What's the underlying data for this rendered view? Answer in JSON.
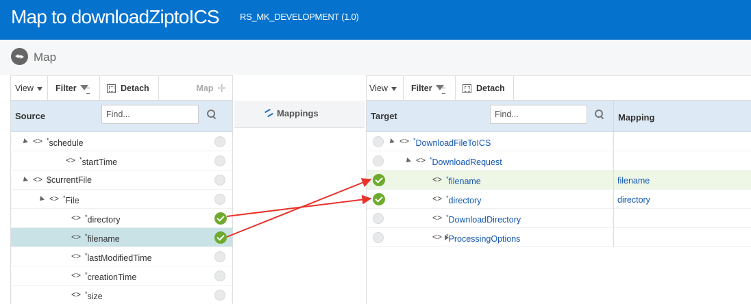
{
  "header": {
    "title": "Map to downloadZiptoICS",
    "subtitle": "RS_MK_DEVELOPMENT (1.0)",
    "accent": "#0572ce"
  },
  "breadcrumb": {
    "map_label": "Map",
    "icon": "map-nav-icon"
  },
  "source": {
    "toolbar": {
      "view": "View",
      "filter": "Filter",
      "detach": "Detach",
      "map": "Map"
    },
    "heading": "Source",
    "find_placeholder": "Find...",
    "rows": [
      {
        "label": "*schedule",
        "expand": "expanded",
        "status": "unmapped"
      },
      {
        "label": "*startTime",
        "expand": "none",
        "status": "unmapped"
      },
      {
        "label": "$currentFile",
        "expand": "expanded",
        "status": "unmapped"
      },
      {
        "label": "*File",
        "expand": "expanded",
        "status": "unmapped"
      },
      {
        "label": "*directory",
        "expand": "none",
        "status": "mapped"
      },
      {
        "label": "*filename",
        "expand": "none",
        "status": "mapped",
        "selected": true
      },
      {
        "label": "*lastModifiedTime",
        "expand": "none",
        "status": "unmapped"
      },
      {
        "label": "*creationTime",
        "expand": "none",
        "status": "unmapped"
      },
      {
        "label": "*size",
        "expand": "none",
        "status": "unmapped"
      }
    ]
  },
  "mappings": {
    "label": "Mappings"
  },
  "target": {
    "toolbar": {
      "view": "View",
      "filter": "Filter",
      "detach": "Detach"
    },
    "heading": "Target",
    "find_placeholder": "Find...",
    "mapping_heading": "Mapping",
    "rows": [
      {
        "label": "*DownloadFileToICS",
        "expand": "expanded",
        "status": "unmapped",
        "mapping": ""
      },
      {
        "label": "*DownloadRequest",
        "expand": "expanded",
        "status": "unmapped",
        "mapping": ""
      },
      {
        "label": "*filename",
        "expand": "none",
        "status": "mapped",
        "mapping": "filename"
      },
      {
        "label": "*directory",
        "expand": "none",
        "status": "mapped",
        "mapping": "directory"
      },
      {
        "label": "*DownloadDirectory",
        "expand": "none",
        "status": "unmapped",
        "mapping": ""
      },
      {
        "label": "*ProcessingOptions",
        "expand": "collapsed",
        "status": "unmapped",
        "mapping": ""
      }
    ]
  },
  "colors": {
    "mapped": "#6eaa2e",
    "arrow": "#e8332a",
    "selected_row": "#c9e2e6"
  }
}
